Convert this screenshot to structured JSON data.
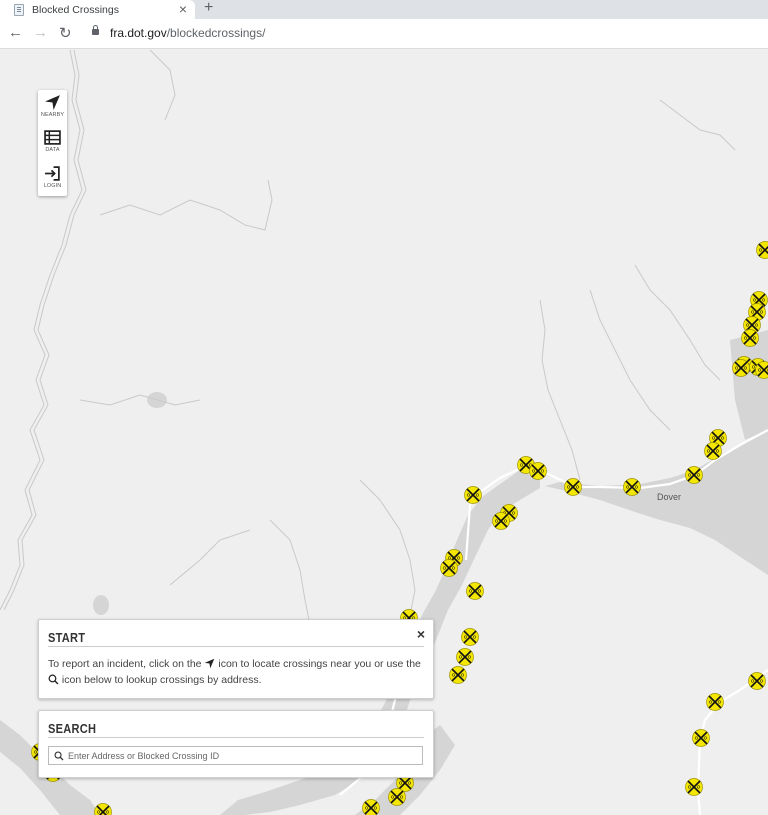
{
  "browser": {
    "tab_title": "Blocked Crossings",
    "tab_close": "×",
    "new_tab": "+",
    "url_host": "fra.dot.gov",
    "url_path": "/blockedcrossings/"
  },
  "toolbar": {
    "nearby_label": "NEARBY",
    "data_label": "DATA",
    "login_label": "LOGIN"
  },
  "map": {
    "place_labels": [
      "Dover"
    ],
    "marker_icon": "railroad-crossing-icon",
    "marker_color": "#f3e600",
    "water_color": "#d4d4d4",
    "land_color": "#efefef"
  },
  "start_panel": {
    "title": "START",
    "close_label": "×",
    "text_1": "To report an incident, click on the",
    "text_2": "icon to locate crossings near you or use the",
    "text_3": "icon below to lookup crossings by address."
  },
  "search_panel": {
    "title": "SEARCH",
    "placeholder": "Enter Address or Blocked Crossing ID"
  }
}
